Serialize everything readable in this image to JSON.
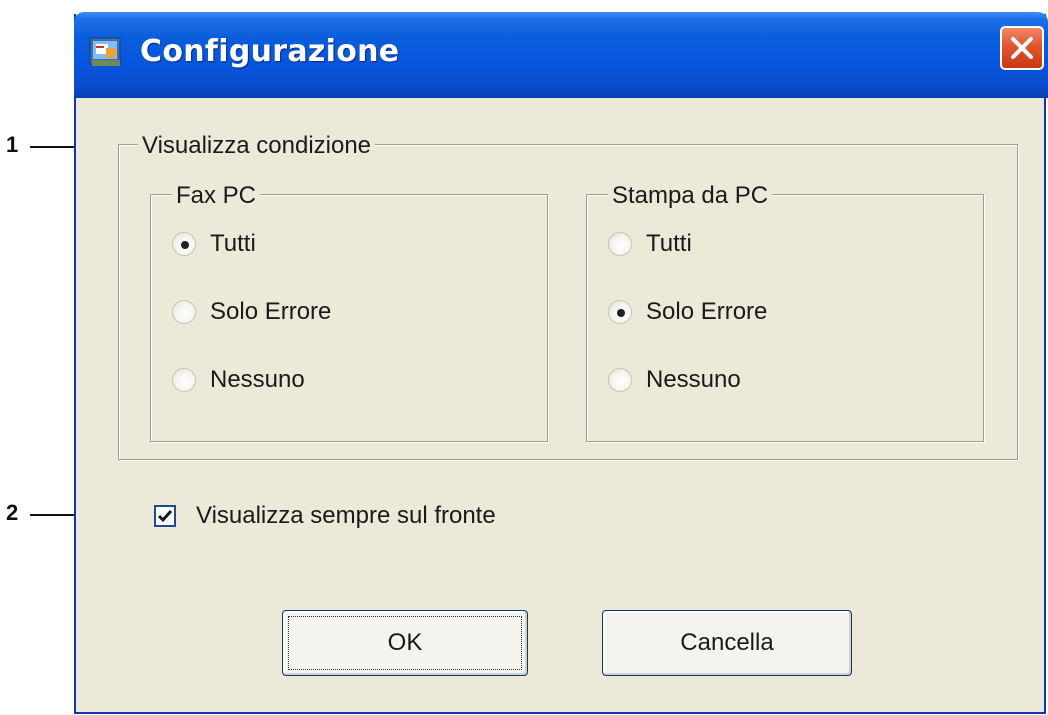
{
  "window": {
    "title": "Configurazione",
    "icon": "printer-monitor-icon",
    "close_icon": "close-icon"
  },
  "display_condition": {
    "legend": "Visualizza condizione",
    "fax_pc": {
      "legend": "Fax PC",
      "options": [
        {
          "label": "Tutti",
          "selected": true
        },
        {
          "label": "Solo Errore",
          "selected": false
        },
        {
          "label": "Nessuno",
          "selected": false
        }
      ]
    },
    "print_pc": {
      "legend": "Stampa da PC",
      "options": [
        {
          "label": "Tutti",
          "selected": false
        },
        {
          "label": "Solo Errore",
          "selected": true
        },
        {
          "label": "Nessuno",
          "selected": false
        }
      ]
    }
  },
  "always_on_top": {
    "label": "Visualizza sempre sul fronte",
    "checked": true
  },
  "buttons": {
    "ok": "OK",
    "cancel": "Cancella"
  },
  "callouts": [
    "1",
    "2"
  ],
  "colors": {
    "titlebar": "#0855dd",
    "dialog_bg": "#ece9d8",
    "close_button": "#e0542e"
  }
}
